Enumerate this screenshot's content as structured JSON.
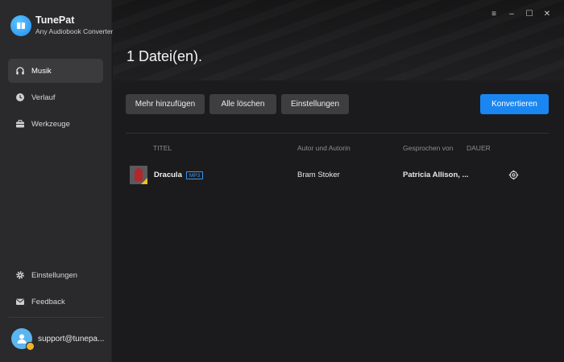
{
  "app": {
    "name": "TunePat",
    "subtitle": "Any Audiobook Converter"
  },
  "sidebar": {
    "items": [
      {
        "label": "Musik",
        "icon": "headphones-icon",
        "active": true
      },
      {
        "label": "Verlauf",
        "icon": "clock-icon",
        "active": false
      },
      {
        "label": "Werkzeuge",
        "icon": "toolbox-icon",
        "active": false
      }
    ],
    "bottom_items": [
      {
        "label": "Einstellungen",
        "icon": "gear-icon"
      },
      {
        "label": "Feedback",
        "icon": "mail-icon"
      }
    ],
    "user": {
      "email": "support@tunepa..."
    }
  },
  "window_controls": {
    "menu": "≡",
    "minimize": "–",
    "maximize": "☐",
    "close": "✕"
  },
  "main": {
    "title": "1 Datei(en).",
    "toolbar": {
      "add_label": "Mehr hinzufügen",
      "clear_label": "Alle löschen",
      "settings_label": "Einstellungen",
      "convert_label": "Konvertieren"
    },
    "table": {
      "columns": [
        "TITEL",
        "Autor und Autorin",
        "Gesprochen von",
        "DAUER"
      ],
      "rows": [
        {
          "title": "Dracula",
          "format": "MP3",
          "author": "Bram Stoker",
          "narrator": "Patricia Allison, ...",
          "duration": ""
        }
      ]
    }
  },
  "colors": {
    "accent": "#1a86f2",
    "sidebar_bg": "#2a2a2c",
    "main_bg": "#1b1b1d"
  }
}
